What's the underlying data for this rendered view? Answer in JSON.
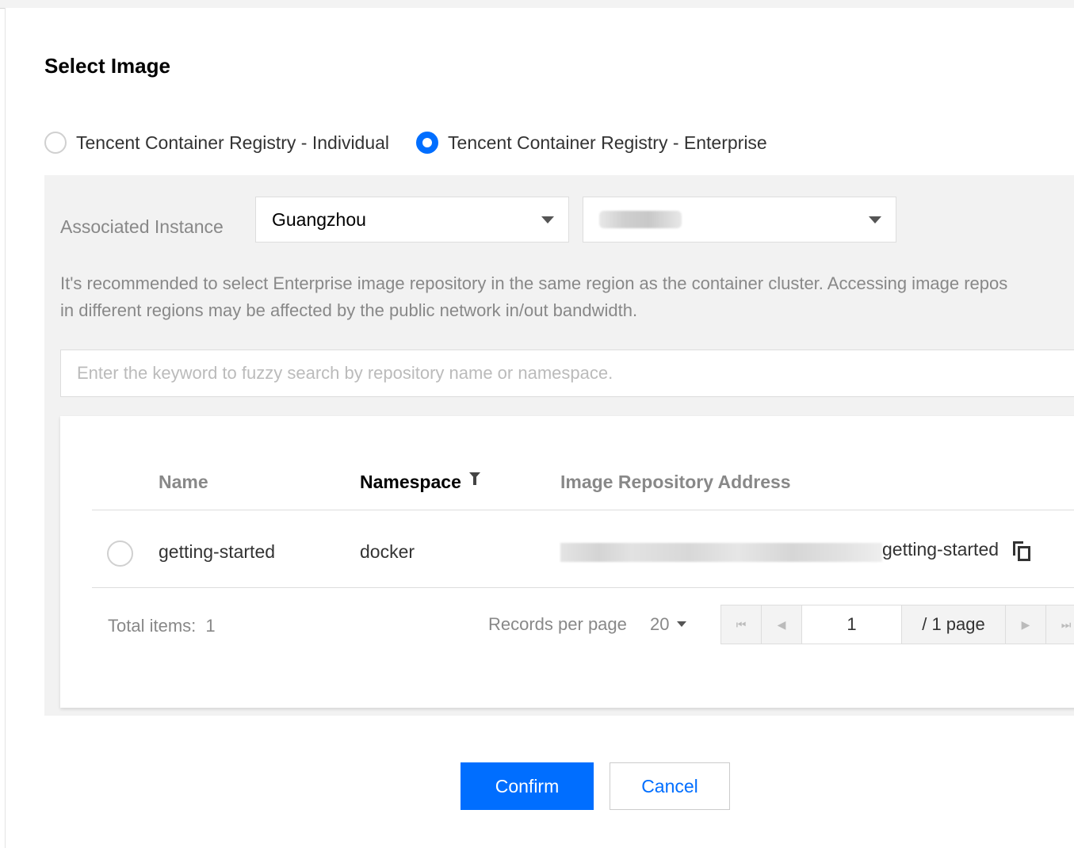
{
  "dialog": {
    "title": "Select Image"
  },
  "registry": {
    "options": [
      {
        "label": "Tencent Container Registry - Individual",
        "selected": false
      },
      {
        "label": "Tencent Container Registry - Enterprise",
        "selected": true
      }
    ]
  },
  "instance": {
    "label": "Associated Instance",
    "region": "Guangzhou",
    "instance_value": "",
    "hint": "It's recommended to select Enterprise image repository in the same region as the container cluster. Accessing image repos\nin different regions may be affected by the public network in/out bandwidth."
  },
  "search": {
    "placeholder": "Enter the keyword to fuzzy search by repository name or namespace."
  },
  "table": {
    "columns": [
      "Name",
      "Namespace",
      "Image Repository Address"
    ],
    "rows": [
      {
        "name": "getting-started",
        "namespace": "docker",
        "address_suffix": "getting-started",
        "selected": false
      }
    ]
  },
  "pagination": {
    "total_label": "Total items:",
    "total": "1",
    "records_per_page_label": "Records per page",
    "records_per_page": "20",
    "current_page": "1",
    "total_pages_label": "/ 1 page"
  },
  "footer": {
    "confirm_label": "Confirm",
    "cancel_label": "Cancel"
  },
  "colors": {
    "accent": "#006eff",
    "panel_bg": "#f2f2f2"
  }
}
